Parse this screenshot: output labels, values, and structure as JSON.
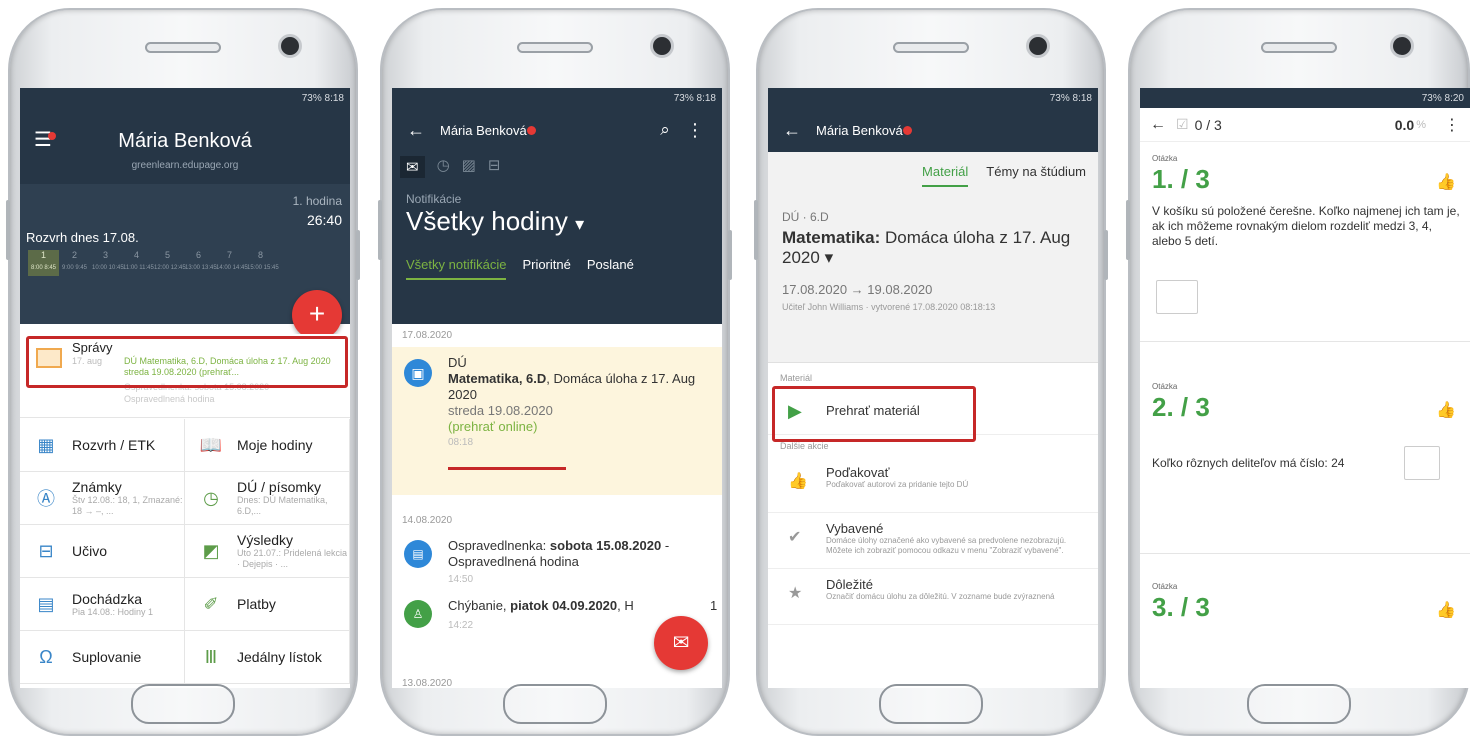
{
  "status_time_1": "8:18",
  "status_time_4": "8:20",
  "status_battery": "73%",
  "screen1": {
    "user_name": "Mária Benková",
    "domain": "greenlearn.edupage.org",
    "lesson_label": "1. hodina",
    "lesson_time": "26:40",
    "timetable_title": "Rozvrh dnes 17.08.",
    "timetable_cols": [
      {
        "n": "1",
        "t": "8:00 8:45"
      },
      {
        "n": "2",
        "t": "9:00 9:45"
      },
      {
        "n": "3",
        "t": "10:00 10:45"
      },
      {
        "n": "4",
        "t": "11:00 11:45"
      },
      {
        "n": "5",
        "t": "12:00 12:45"
      },
      {
        "n": "6",
        "t": "13:00 13:45"
      },
      {
        "n": "7",
        "t": "14:00 14:45"
      },
      {
        "n": "8",
        "t": "15:00 15:45"
      }
    ],
    "fab": "+",
    "messages_title": "Správy",
    "messages_date": "17. aug",
    "messages_text": "DÚ Matematika, 6.D, Domáca úloha z 17. Aug 2020 streda 19.08.2020 (prehrať...",
    "messages_text2": "Ospravedlnenka: sobota 15.08.2020",
    "messages_text3": "Ospravedlnená hodina",
    "tiles": [
      {
        "title": "Rozvrh / ETK",
        "sub": "",
        "icon": "calendar-icon"
      },
      {
        "title": "Moje hodiny",
        "sub": "",
        "icon": "book-icon"
      },
      {
        "title": "Známky",
        "sub": "Štv 12.08.: 18, 1, Zmazané: 18 → –, ...",
        "icon": "grade-icon"
      },
      {
        "title": "DÚ / písomky",
        "sub": "Dnes: DÚ Matematika, 6.D,...",
        "icon": "clock-icon"
      },
      {
        "title": "Učivo",
        "sub": "",
        "icon": "briefcase-icon"
      },
      {
        "title": "Výsledky",
        "sub": "Uto 21.07.: Pridelená lekcia · Dejepis · ...",
        "icon": "chart-icon"
      },
      {
        "title": "Dochádzka",
        "sub": "Pia 14.08.: Hodiny 1",
        "icon": "attendance-icon"
      },
      {
        "title": "Platby",
        "sub": "",
        "icon": "payment-icon"
      },
      {
        "title": "Suplovanie",
        "sub": "",
        "icon": "substitution-icon"
      },
      {
        "title": "Jedálny lístok",
        "sub": "",
        "icon": "food-icon"
      }
    ]
  },
  "screen2": {
    "user_name": "Mária Benková",
    "notif_label": "Notifikácie",
    "filter": "Všetky hodiny",
    "tabs": [
      "Všetky notifikácie",
      "Prioritné",
      "Poslané"
    ],
    "date1": "17.08.2020",
    "n1_type": "DÚ",
    "n1_bold": "Matematika",
    "n1_class": ", 6.D",
    "n1_rest": ", Domáca úloha z 17. Aug 2020",
    "n1_day": "streda 19.08.2020",
    "n1_link": "(prehrať online)",
    "n1_time": "08:18",
    "date2": "14.08.2020",
    "n2_prefix": "Ospravedlnenka:",
    "n2_bold": "sobota 15.08.2020",
    "n2_rest": "- Ospravedlnená hodina",
    "n2_time": "14:50",
    "n3_prefix": "Chýbanie,",
    "n3_bold": "piatok 04.09.2020",
    "n3_rest": ", H",
    "n3_suffix": "1",
    "n3_time": "14:22",
    "date3": "13.08.2020"
  },
  "screen3": {
    "user_name": "Mária Benková",
    "tab_material": "Materiál",
    "tab_topics": "Témy na štúdium",
    "breadcrumb": "DÚ · 6.D",
    "title_bold": "Matematika:",
    "title_rest": "Domáca úloha z 17. Aug 2020",
    "dates": "17.08.2020 → 19.08.2020",
    "teacher": "Učiteľ John Williams · vytvorené 17.08.2020 08:18:13",
    "section_material": "Materiál",
    "play_label": "Prehrať materiál",
    "section_actions": "Ďalšie akcie",
    "actions": [
      {
        "title": "Poďakovať",
        "desc": "Poďakovať autorovi za pridanie tejto DÚ",
        "icon": "thumbs-up-icon"
      },
      {
        "title": "Vybavené",
        "desc": "Domáce úlohy označené ako vybavené sa predvolene nezobrazujú. Môžete ich zobraziť pomocou odkazu v menu \"Zobraziť vybavené\".",
        "icon": "check-icon"
      },
      {
        "title": "Dôležité",
        "desc": "Označiť domácu úlohu za dôležitú. V zozname bude zvýraznená",
        "icon": "star-icon"
      }
    ]
  },
  "screen4": {
    "progress": "0 / 3",
    "score": "0.0",
    "score_unit": "%",
    "q_label": "Otázka",
    "questions": [
      {
        "num": "1. / 3",
        "text": "V košíku sú položené čerešne. Koľko najmenej ich tam je, ak ich môžeme rovnakým dielom rozdeliť medzi 3, 4, alebo 5 detí."
      },
      {
        "num": "2. / 3",
        "text": "Koľko rôznych deliteľov má číslo: 24"
      },
      {
        "num": "3. / 3",
        "text": ""
      }
    ]
  }
}
